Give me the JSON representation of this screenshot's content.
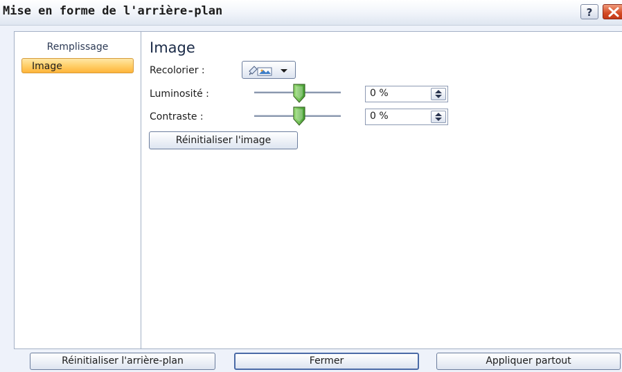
{
  "dialog": {
    "title": "Mise en forme de l'arrière-plan",
    "help_label": "?"
  },
  "sidebar": {
    "items": [
      {
        "label": "Remplissage",
        "active": false
      },
      {
        "label": "Image",
        "active": true
      }
    ]
  },
  "image_section": {
    "title": "Image",
    "recolor": {
      "label": "Recolorier :",
      "icon": "recolor-icon"
    },
    "brightness": {
      "label": "Luminosité :",
      "value": "0 %",
      "level": 0
    },
    "contrast": {
      "label": "Contraste :",
      "value": "0 %",
      "level": 0
    },
    "reset_image_label": "Réinitialiser l'image"
  },
  "footer": {
    "reset_background_label": "Réinitialiser l'arrière-plan",
    "close_label": "Fermer",
    "apply_all_label": "Appliquer partout"
  },
  "colors": {
    "accent_active": "#ffcf6a",
    "close_red": "#d44a24",
    "border": "#a3b0c5"
  }
}
